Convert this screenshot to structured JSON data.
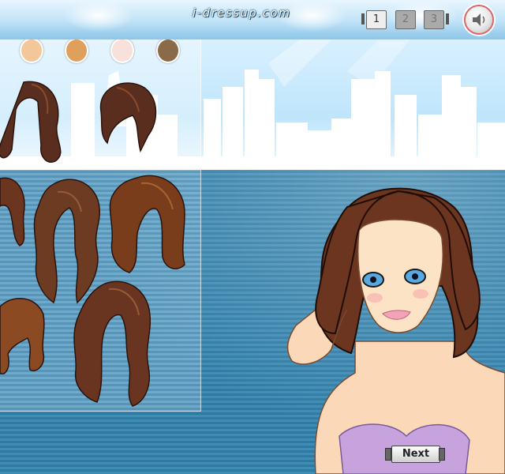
{
  "header": {
    "logo_text": "i-dressup.com",
    "pages": [
      {
        "label": "1",
        "active": true
      },
      {
        "label": "2",
        "active": false
      },
      {
        "label": "3",
        "active": false
      }
    ],
    "sound_icon": "speaker-icon"
  },
  "panel": {
    "skin_tones": [
      "#f2c89a",
      "#dfa05e",
      "#f8e1da",
      "#8b6a4a"
    ],
    "hairstyles": [
      {
        "name": "hairstyle-long-wavy",
        "color": "#5a2e1e"
      },
      {
        "name": "hairstyle-short-bob",
        "color": "#5a2e1e"
      },
      {
        "name": "hairstyle-long-side",
        "color": "#6b3520"
      },
      {
        "name": "hairstyle-long-curly",
        "color": "#6d3a22"
      },
      {
        "name": "hairstyle-voluminous",
        "color": "#7a3d1c"
      },
      {
        "name": "hairstyle-bangs-short",
        "color": "#8b4a22"
      },
      {
        "name": "hairstyle-long-curls",
        "color": "#6a3520"
      }
    ]
  },
  "navigation": {
    "next_label": "Next"
  }
}
